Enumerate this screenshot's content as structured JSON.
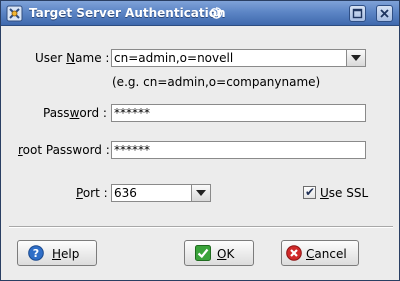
{
  "window": {
    "title": "Target Server Authentication"
  },
  "form": {
    "username": {
      "label_pre": "User ",
      "label_u": "N",
      "label_post": "ame :",
      "value": "cn=admin,o=novell",
      "hint": "(e.g. cn=admin,o=companyname)"
    },
    "password": {
      "label_pre": "Pass",
      "label_u": "w",
      "label_post": "ord :",
      "value": "******"
    },
    "root_password": {
      "label_pre": "",
      "label_u": "r",
      "label_post": "oot Password :",
      "value": "******"
    },
    "port": {
      "label_pre": "",
      "label_u": "P",
      "label_post": "ort :",
      "value": "636"
    },
    "use_ssl": {
      "label_pre": "",
      "label_u": "U",
      "label_post": "se SSL",
      "checked": true
    }
  },
  "buttons": {
    "help": {
      "label_pre": "",
      "label_u": "H",
      "label_post": "elp"
    },
    "ok": {
      "label_pre": "",
      "label_u": "O",
      "label_post": "K"
    },
    "cancel": {
      "label_pre": "",
      "label_u": "C",
      "label_post": "ancel"
    }
  },
  "icons": {
    "app": "app-icon",
    "spiral": "debian-spiral-icon",
    "help": "help-icon",
    "ok": "checkmark-icon",
    "cancel": "cancel-icon",
    "dropdown": "chevron-down-icon"
  },
  "colors": {
    "titlebar": "#5d86c6",
    "help_icon": "#2f6ec7",
    "ok_icon": "#3aa33a",
    "cancel_icon": "#d02a2a"
  }
}
